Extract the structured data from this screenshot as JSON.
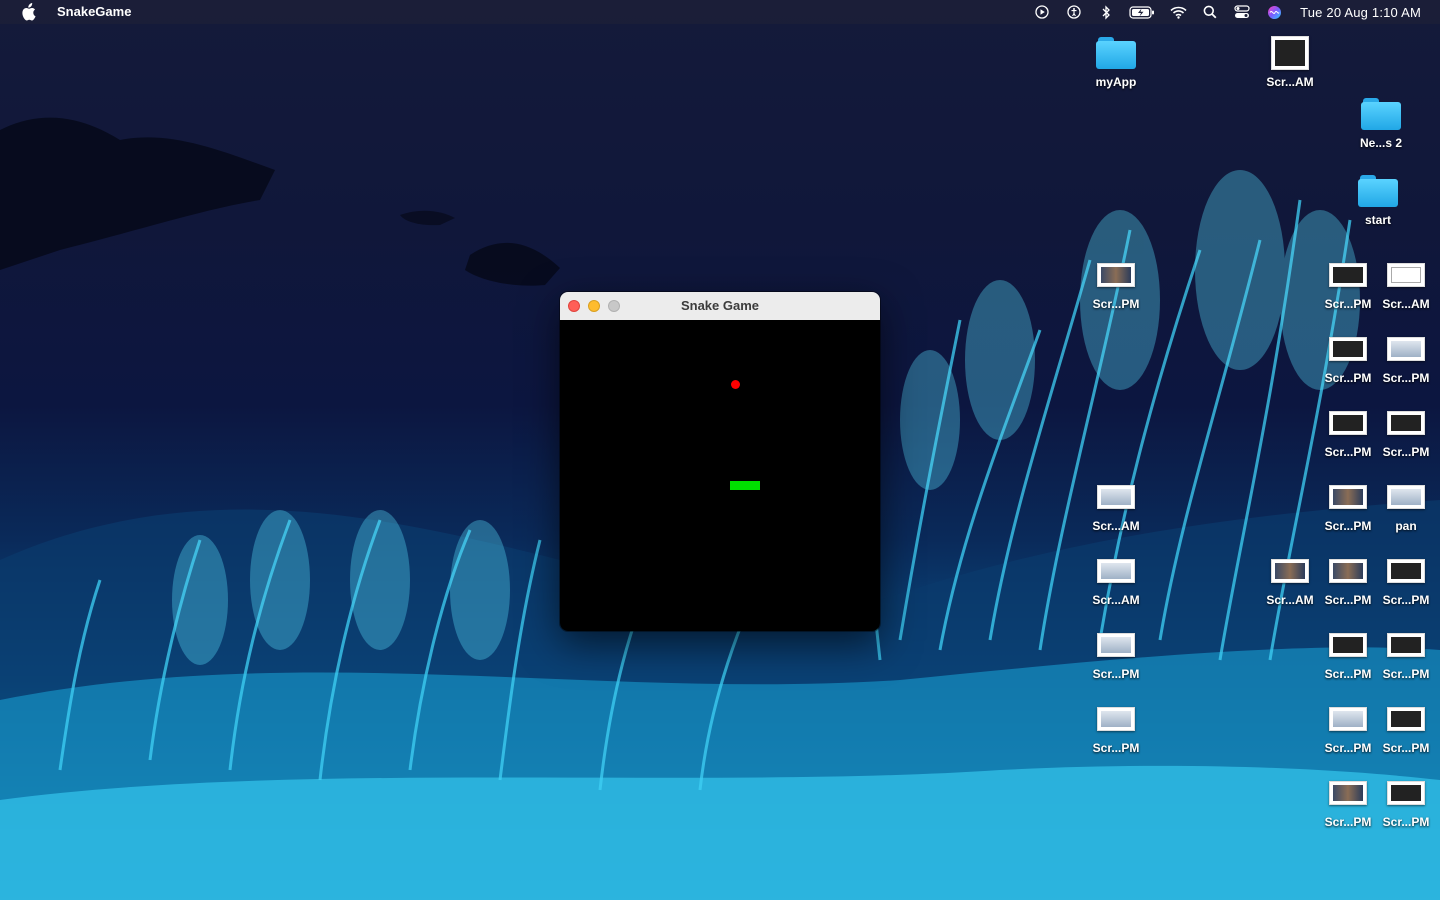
{
  "menubar": {
    "app_name": "SnakeGame",
    "clock": "Tue 20 Aug  1:10 AM",
    "status_icons": [
      "play-circle-icon",
      "accessibility-icon",
      "bluetooth-icon",
      "battery-charging-icon",
      "wifi-icon",
      "search-icon",
      "control-center-icon",
      "siri-icon"
    ]
  },
  "window": {
    "title": "Snake Game",
    "board_color": "#000000",
    "snake_color": "#00e000",
    "food_color": "#ff0000"
  },
  "desktop": {
    "icons": [
      {
        "label": "myApp",
        "kind": "folder"
      },
      {
        "label": "Scr...AM",
        "kind": "screenshot"
      },
      {
        "label": "Ne...s 2",
        "kind": "folder"
      },
      {
        "label": "start",
        "kind": "folder"
      },
      {
        "label": "Scr...PM",
        "kind": "screenshot"
      },
      {
        "label": "Scr...PM",
        "kind": "screenshot"
      },
      {
        "label": "Scr...AM",
        "kind": "screenshot"
      },
      {
        "label": "Scr...PM",
        "kind": "screenshot"
      },
      {
        "label": "Scr...PM",
        "kind": "screenshot"
      },
      {
        "label": "Scr...PM",
        "kind": "screenshot"
      },
      {
        "label": "Scr...PM",
        "kind": "screenshot"
      },
      {
        "label": "Scr...AM",
        "kind": "screenshot"
      },
      {
        "label": "Scr...PM",
        "kind": "screenshot"
      },
      {
        "label": "pan",
        "kind": "image"
      },
      {
        "label": "Scr...AM",
        "kind": "screenshot"
      },
      {
        "label": "Scr...AM",
        "kind": "screenshot"
      },
      {
        "label": "Scr...PM",
        "kind": "screenshot"
      },
      {
        "label": "Scr...PM",
        "kind": "screenshot"
      },
      {
        "label": "Scr...PM",
        "kind": "screenshot"
      },
      {
        "label": "Scr...PM",
        "kind": "screenshot"
      },
      {
        "label": "Scr...PM",
        "kind": "screenshot"
      },
      {
        "label": "Scr...PM",
        "kind": "screenshot"
      },
      {
        "label": "Scr...PM",
        "kind": "screenshot"
      },
      {
        "label": "Scr...PM",
        "kind": "screenshot"
      },
      {
        "label": "Scr...PM",
        "kind": "screenshot"
      },
      {
        "label": "Scr...PM",
        "kind": "screenshot"
      }
    ]
  }
}
